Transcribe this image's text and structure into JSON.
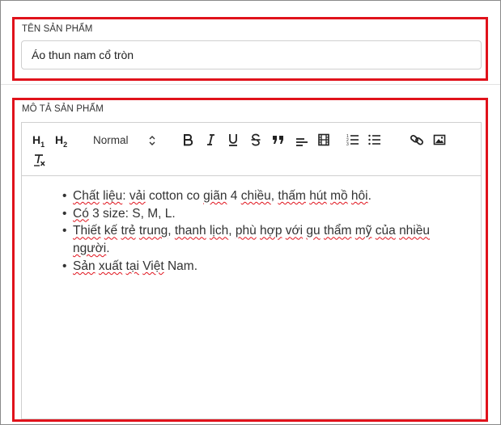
{
  "product_name": {
    "label": "TÊN SẢN PHẨM",
    "value": "Áo thun nam cổ tròn"
  },
  "product_description": {
    "label": "MÔ TẢ SẢN PHẨM",
    "toolbar": {
      "h1": "H",
      "h1_sub": "1",
      "h2": "H",
      "h2_sub": "2",
      "format_select": "Normal",
      "icons": [
        "bold-icon",
        "italic-icon",
        "underline-icon",
        "strikethrough-icon",
        "quote-icon",
        "align-icon",
        "video-icon",
        "ordered-list-icon",
        "bullet-list-icon",
        "link-icon",
        "image-icon",
        "clear-format-icon"
      ]
    },
    "bullets": [
      [
        {
          "t": "Chất",
          "sq": true
        },
        {
          "t": " "
        },
        {
          "t": "liệu",
          "sq": true
        },
        {
          "t": ": "
        },
        {
          "t": "vải",
          "sq": true
        },
        {
          "t": " cotton co "
        },
        {
          "t": "giãn",
          "sq": true
        },
        {
          "t": " 4 "
        },
        {
          "t": "chiều",
          "sq": true
        },
        {
          "t": ", "
        },
        {
          "t": "thấm",
          "sq": true
        },
        {
          "t": " "
        },
        {
          "t": "hút",
          "sq": true
        },
        {
          "t": " "
        },
        {
          "t": "mồ",
          "sq": true
        },
        {
          "t": " "
        },
        {
          "t": "hôi",
          "sq": true
        },
        {
          "t": "."
        }
      ],
      [
        {
          "t": "Có",
          "sq": true
        },
        {
          "t": " 3 size: S, M, L."
        }
      ],
      [
        {
          "t": "Thiết",
          "sq": true
        },
        {
          "t": " "
        },
        {
          "t": "kế",
          "sq": true
        },
        {
          "t": " "
        },
        {
          "t": "trẻ",
          "sq": true
        },
        {
          "t": " "
        },
        {
          "t": "trung",
          "sq": true
        },
        {
          "t": ", "
        },
        {
          "t": "thanh",
          "sq": true
        },
        {
          "t": " "
        },
        {
          "t": "lịch",
          "sq": true
        },
        {
          "t": ", "
        },
        {
          "t": "phù",
          "sq": true
        },
        {
          "t": " "
        },
        {
          "t": "hợp",
          "sq": true
        },
        {
          "t": " "
        },
        {
          "t": "với",
          "sq": true
        },
        {
          "t": " "
        },
        {
          "t": "gu",
          "sq": true
        },
        {
          "t": " "
        },
        {
          "t": "thẩm",
          "sq": true
        },
        {
          "t": " "
        },
        {
          "t": "mỹ",
          "sq": true
        },
        {
          "t": " "
        },
        {
          "t": "của",
          "sq": true
        },
        {
          "t": " "
        },
        {
          "t": "nhiều",
          "sq": true
        },
        {
          "t": " "
        },
        {
          "t": "người",
          "sq": true
        },
        {
          "t": "."
        }
      ],
      [
        {
          "t": "Sản",
          "sq": true
        },
        {
          "t": " "
        },
        {
          "t": "xuất",
          "sq": true
        },
        {
          "t": " "
        },
        {
          "t": "tại",
          "sq": true
        },
        {
          "t": " "
        },
        {
          "t": "Việt",
          "sq": true
        },
        {
          "t": " Nam."
        }
      ]
    ]
  },
  "colors": {
    "highlight_border": "#e0121b",
    "input_border": "#cfcfcf",
    "spellcheck_underline": "#e0121b"
  }
}
